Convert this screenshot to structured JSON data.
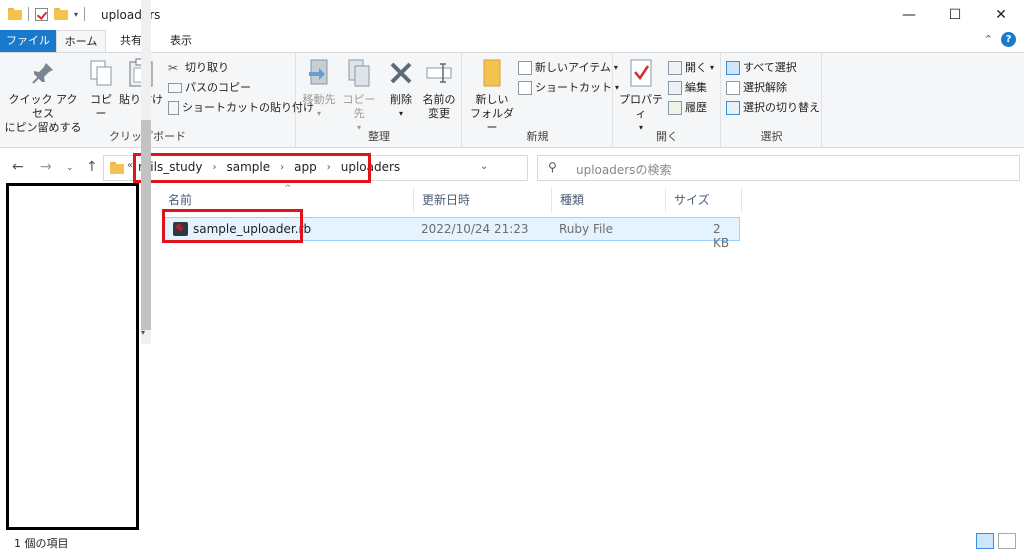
{
  "window": {
    "title": "uploaders",
    "minimize": "—",
    "maximize": "☐",
    "close": "✕"
  },
  "tabs": {
    "file": "ファイル",
    "home": "ホーム",
    "share": "共有",
    "view": "表示"
  },
  "ribbon": {
    "clipboard": {
      "label": "クリップボード",
      "pin_line1": "クイック アクセス",
      "pin_line2": "にピン留めする",
      "copy": "コピー",
      "paste": "貼り付け",
      "cut": "切り取り",
      "copy_path": "パスのコピー",
      "paste_shortcut": "ショートカットの貼り付け"
    },
    "organize": {
      "label": "整理",
      "move_to": "移動先",
      "copy_to": "コピー先",
      "delete": "削除",
      "rename_line1": "名前の",
      "rename_line2": "変更"
    },
    "new": {
      "label": "新規",
      "new_folder_line1": "新しい",
      "new_folder_line2": "フォルダー",
      "new_item": "新しいアイテム",
      "shortcut": "ショートカット"
    },
    "open": {
      "label": "開く",
      "properties": "プロパティ",
      "open": "開く",
      "edit": "編集",
      "history": "履歴"
    },
    "select": {
      "label": "選択",
      "select_all": "すべて選択",
      "select_none": "選択解除",
      "invert": "選択の切り替え"
    }
  },
  "address": {
    "crumbs": [
      "rails_study",
      "sample",
      "app",
      "uploaders"
    ],
    "search_placeholder": "uploadersの検索"
  },
  "columns": {
    "name": "名前",
    "modified": "更新日時",
    "type": "種類",
    "size": "サイズ"
  },
  "files": [
    {
      "name": "sample_uploader.rb",
      "modified": "2022/10/24 21:23",
      "type": "Ruby File",
      "size": "2 KB"
    }
  ],
  "status": {
    "count": "1 個の項目"
  },
  "colors": {
    "accent": "#1979ca",
    "highlight": "#e0121c",
    "folder": "#f4c24e"
  }
}
